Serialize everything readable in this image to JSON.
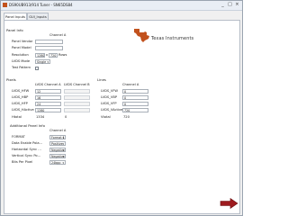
{
  "window": {
    "title": "DS90UB913/914 Tuner - SN65DS84",
    "min": "_",
    "max": "□",
    "close": "×"
  },
  "tabs": [
    {
      "label": "Panel Inputs",
      "active": true
    },
    {
      "label": "GUI_Inputs",
      "active": false
    }
  ],
  "logo": {
    "text": "Texas Instruments"
  },
  "panel_info": {
    "heading": "Panel Info",
    "channel_header": "Channel A",
    "panel_vendor_label": "Panel Vendor",
    "panel_vendor_value": "",
    "panel_model_label": "Panel Model",
    "panel_model_value": "",
    "resolution_label": "Resolution",
    "res_width": "1280",
    "res_x": "x",
    "res_height": "720",
    "res_unit": "Rows",
    "lvds_mode_label": "LVDS Mode",
    "lvds_mode_value": "Single",
    "test_pattern_label": "Test Pattern",
    "test_pattern_checked": false
  },
  "pixels": {
    "heading": "Pixels",
    "col_a": "LVDS Channel A",
    "col_b": "LVDS Channel B",
    "rows": [
      {
        "label": "LVDS_HFW",
        "a": "12",
        "b": ""
      },
      {
        "label": "LVDS_HBP",
        "a": "16",
        "b": ""
      },
      {
        "label": "LVDS_HFP",
        "a": "24",
        "b": ""
      },
      {
        "label": "LVDS_HActive",
        "a": "1280",
        "b": ""
      }
    ],
    "total_label": "Htotal",
    "total_a": "1334",
    "total_b": "0"
  },
  "lines": {
    "heading": "Lines",
    "col_a": "Channel A",
    "rows": [
      {
        "label": "LVDS_VFW",
        "a": "0"
      },
      {
        "label": "LVDS_VBP",
        "a": "0"
      },
      {
        "label": "LVDS_VFP",
        "a": "0"
      },
      {
        "label": "LVDS_VActive",
        "a": "720"
      }
    ],
    "total_label": "Vtotal",
    "total_a": "720"
  },
  "additional": {
    "heading": "Additional Panel Info",
    "channel_header": "Channel A",
    "rows": [
      {
        "label": "FORMAT",
        "value": "Format 1"
      },
      {
        "label": "Data Enable Pola...",
        "value": "Positive"
      },
      {
        "label": "Horizontal Sync ...",
        "value": "Negative"
      },
      {
        "label": "Vertical Sync Po...",
        "value": "Negative"
      },
      {
        "label": "Bits Per Pixel",
        "value": "24bpp"
      }
    ]
  },
  "colors": {
    "accent": "#c4252b",
    "logo": "#c2521d"
  },
  "icons": {
    "next": "arrow-right-icon",
    "logo": "ti-map-icon"
  }
}
